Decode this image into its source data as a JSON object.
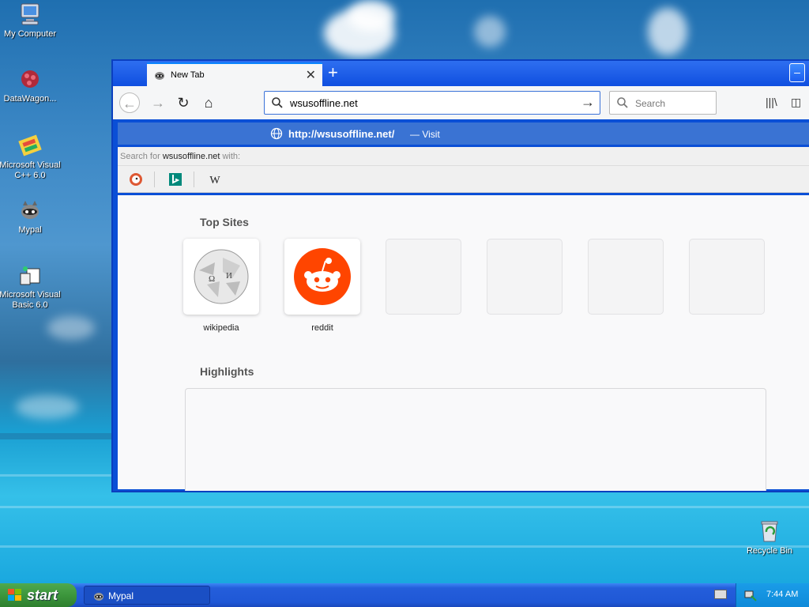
{
  "desktop": {
    "icons": [
      {
        "label": "My Computer"
      },
      {
        "label": "DataWagon..."
      },
      {
        "label": "Microsoft Visual C++ 6.0"
      },
      {
        "label": "Mypal"
      },
      {
        "label": "Microsoft Visual Basic 6.0"
      },
      {
        "label": "Recycle Bin"
      }
    ]
  },
  "browser": {
    "tab": {
      "title": "New Tab",
      "close": "✕"
    },
    "new_tab": "+",
    "url_value": "wsusoffline.net",
    "search_placeholder": "Search",
    "suggestion": {
      "url": "http://wsusoffline.net/",
      "visit": "— Visit"
    },
    "search_with": {
      "prefix": "Search for ",
      "term": "wsusoffline.net",
      "suffix": " with:"
    },
    "engines": [
      "duckduckgo-icon",
      "bing-icon",
      "wikipedia-icon"
    ],
    "top_sites_title": "Top Sites",
    "top_sites": [
      {
        "label": "wikipedia"
      },
      {
        "label": "reddit"
      }
    ],
    "highlights_title": "Highlights"
  },
  "taskbar": {
    "start_label": "start",
    "task_label": "Mypal",
    "clock": "7:44 AM"
  },
  "colors": {
    "accent": "#0a84ff",
    "suggest_bg": "#3a73d3",
    "reddit": "#ff4500"
  }
}
